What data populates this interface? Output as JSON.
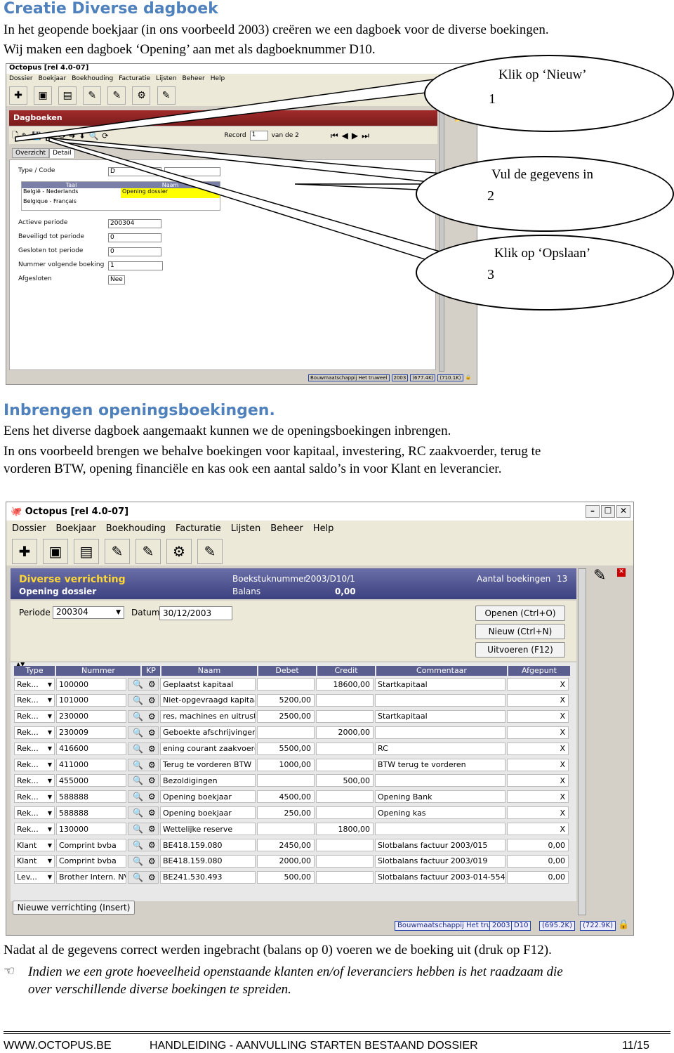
{
  "section1": {
    "title": "Creatie Diverse dagboek",
    "line1": "In het geopende boekjaar (in ons voorbeeld 2003) creëren we een dagboek voor de diverse boekingen.",
    "line2": "Wij maken een dagboek ‘Opening’ aan met als dagboeknummer D10."
  },
  "screen1": {
    "window_title": "Octopus [rel 4.0-07]",
    "menu": [
      "Dossier",
      "Boekjaar",
      "Boekhouding",
      "Facturatie",
      "Lijsten",
      "Beheer",
      "Help"
    ],
    "panel_title": "Dagboeken",
    "record_label": "Record",
    "record_value": "1",
    "record_of": "van de 2",
    "tabs": [
      "Overzicht",
      "Detail"
    ],
    "type_code_label": "Type / Code",
    "type_value": "D",
    "lang_table_headers": [
      "Taal",
      "Naam"
    ],
    "lang_rows": [
      {
        "taal": "België - Nederlands",
        "naam": "Opening dossier"
      },
      {
        "taal": "Belgique - Français",
        "naam": ""
      }
    ],
    "fields": [
      {
        "label": "Actieve periode",
        "value": "200304"
      },
      {
        "label": "Beveiligd tot periode",
        "value": "0"
      },
      {
        "label": "Gesloten tot periode",
        "value": "0"
      },
      {
        "label": "Nummer volgende boeking",
        "value": "1"
      },
      {
        "label": "Afgesloten",
        "value": "Nee"
      }
    ],
    "status": [
      "Bouwmaatschappij Het truweel",
      "2003",
      "(677.4K)",
      "(710.1K)"
    ]
  },
  "callouts": [
    {
      "num": "1",
      "text": "Klik op ‘Nieuw’"
    },
    {
      "num": "2",
      "text": "Vul de gegevens in"
    },
    {
      "num": "3",
      "text": "Klik op ‘Opslaan’"
    }
  ],
  "section2": {
    "title": "Inbrengen openingsboekingen.",
    "line1": "Eens het diverse dagboek aangemaakt kunnen we de openingsboekingen inbrengen.",
    "line2": "In ons voorbeeld brengen we behalve boekingen voor kapitaal, investering, RC zaakvoerder, terug te",
    "line3": "vorderen BTW, opening financiële en kas ook een aantal saldo’s in voor Klant en leverancier."
  },
  "screen2": {
    "window_title": "Octopus [rel 4.0-07]",
    "menu": [
      "Dossier",
      "Boekjaar",
      "Boekhouding",
      "Facturatie",
      "Lijsten",
      "Beheer",
      "Help"
    ],
    "header_title": "Diverse verrichting",
    "header_sub": "Opening dossier",
    "boekstuk_label": "Boekstuknummer",
    "boekstuk_value": "2003/D10/1",
    "balans_label": "Balans",
    "balans_value": "0,00",
    "aantal_label": "Aantal boekingen",
    "aantal_value": "13",
    "periode_label": "Periode",
    "periode_value": "200304",
    "datum_label": "Datum",
    "datum_value": "30/12/2003",
    "buttons": [
      "Openen (Ctrl+O)",
      "Nieuw (Ctrl+N)",
      "Uitvoeren (F12)"
    ],
    "columns": [
      "Type",
      "Nummer",
      "KP",
      "Naam",
      "Debet",
      "Credit",
      "Commentaar",
      "Afgepunt"
    ],
    "rows": [
      {
        "type": "Rek...",
        "nummer": "100000",
        "naam": "Geplaatst kapitaal",
        "debet": "",
        "credit": "18600,00",
        "comment": "Startkapitaal",
        "afg": "X"
      },
      {
        "type": "Rek...",
        "nummer": "101000",
        "naam": "Niet-opgevraagd kapitaal",
        "debet": "5200,00",
        "credit": "",
        "comment": "",
        "afg": "X"
      },
      {
        "type": "Rek...",
        "nummer": "230000",
        "naam": "res, machines en uitrusting",
        "debet": "2500,00",
        "credit": "",
        "comment": "Startkapitaal",
        "afg": "X"
      },
      {
        "type": "Rek...",
        "nummer": "230009",
        "naam": "Geboekte afschrijvingen",
        "debet": "",
        "credit": "2000,00",
        "comment": "",
        "afg": "X"
      },
      {
        "type": "Rek...",
        "nummer": "416600",
        "naam": "ening courant zaakvoerder",
        "debet": "5500,00",
        "credit": "",
        "comment": "RC",
        "afg": "X"
      },
      {
        "type": "Rek...",
        "nummer": "411000",
        "naam": "Terug te vorderen BTW",
        "debet": "1000,00",
        "credit": "",
        "comment": "BTW terug te vorderen",
        "afg": "X"
      },
      {
        "type": "Rek...",
        "nummer": "455000",
        "naam": "Bezoldigingen",
        "debet": "",
        "credit": "500,00",
        "comment": "",
        "afg": "X"
      },
      {
        "type": "Rek...",
        "nummer": "588888",
        "naam": "Opening boekjaar",
        "debet": "4500,00",
        "credit": "",
        "comment": "Opening Bank",
        "afg": "X"
      },
      {
        "type": "Rek...",
        "nummer": "588888",
        "naam": "Opening boekjaar",
        "debet": "250,00",
        "credit": "",
        "comment": "Opening kas",
        "afg": "X"
      },
      {
        "type": "Rek...",
        "nummer": "130000",
        "naam": "Wettelijke reserve",
        "debet": "",
        "credit": "1800,00",
        "comment": "",
        "afg": "X"
      },
      {
        "type": "Klant",
        "nummer": "Comprint bvba",
        "naam": "BE418.159.080",
        "debet": "2450,00",
        "credit": "",
        "comment": "Slotbalans factuur 2003/015",
        "afg": "0,00"
      },
      {
        "type": "Klant",
        "nummer": "Comprint bvba",
        "naam": "BE418.159.080",
        "debet": "2000,00",
        "credit": "",
        "comment": "Slotbalans factuur 2003/019",
        "afg": "0,00"
      },
      {
        "type": "Lev...",
        "nummer": "Brother Intern. NV",
        "naam": "BE241.530.493",
        "debet": "500,00",
        "credit": "",
        "comment": "Slotbalans factuur 2003-014-554",
        "afg": "0,00"
      }
    ],
    "new_button": "Nieuwe verrichting (Insert)",
    "status": [
      "Bouwmaatschappij Het truweel",
      "2003",
      "D10",
      "(695.2K)",
      "(722.9K)"
    ]
  },
  "footer_text": {
    "line1": "Nadat al de gegevens correct werden ingebracht (balans op 0) voeren we de boeking uit (druk op F12).",
    "tip1": "Indien we een grote hoeveelheid openstaande klanten en/of leveranciers hebben is het raadzaam die",
    "tip2": "over verschillende diverse boekingen te spreiden."
  },
  "page_footer": {
    "site": "WWW.OCTOPUS.BE",
    "doc": "HANDLEIDING - AANVULLING STARTEN BESTAAND DOSSIER",
    "page": "11/15"
  }
}
